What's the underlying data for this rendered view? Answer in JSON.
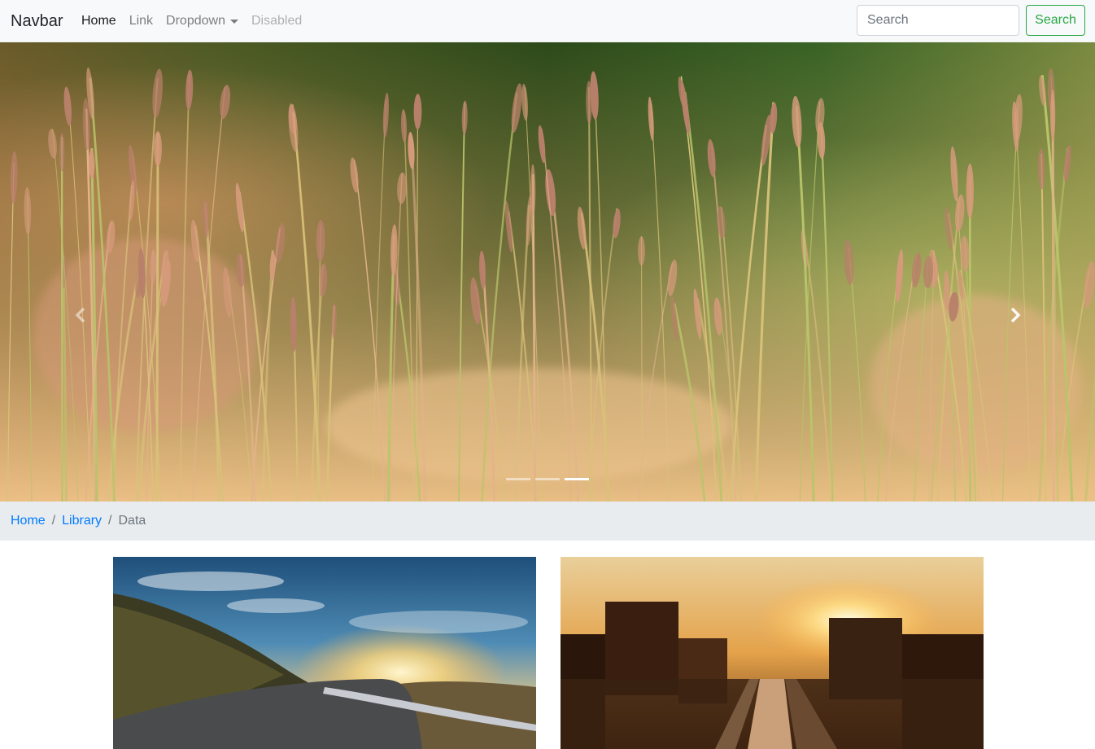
{
  "navbar": {
    "brand": "Navbar",
    "links": [
      {
        "label": "Home",
        "state": "active"
      },
      {
        "label": "Link",
        "state": "normal"
      },
      {
        "label": "Dropdown",
        "state": "dropdown"
      },
      {
        "label": "Disabled",
        "state": "disabled"
      }
    ],
    "search": {
      "placeholder": "Search",
      "value": "",
      "button_label": "Search"
    }
  },
  "carousel": {
    "image": "tall grass seed heads at sunset over green bokeh",
    "prev_icon": "chevron-left-icon",
    "next_icon": "chevron-right-icon",
    "slide_count": 3,
    "active_slide": 3
  },
  "breadcrumb": {
    "items": [
      {
        "label": "Home",
        "link": true
      },
      {
        "label": "Library",
        "link": true
      },
      {
        "label": "Data",
        "link": false
      }
    ]
  },
  "cards": [
    {
      "image": "coastal road at sunset with hills"
    },
    {
      "image": "city highway and railway at sunset"
    }
  ],
  "colors": {
    "navbar_bg": "#f8f9fa",
    "link_primary": "#007bff",
    "success": "#28a745",
    "breadcrumb_bg": "#e9ecef"
  }
}
